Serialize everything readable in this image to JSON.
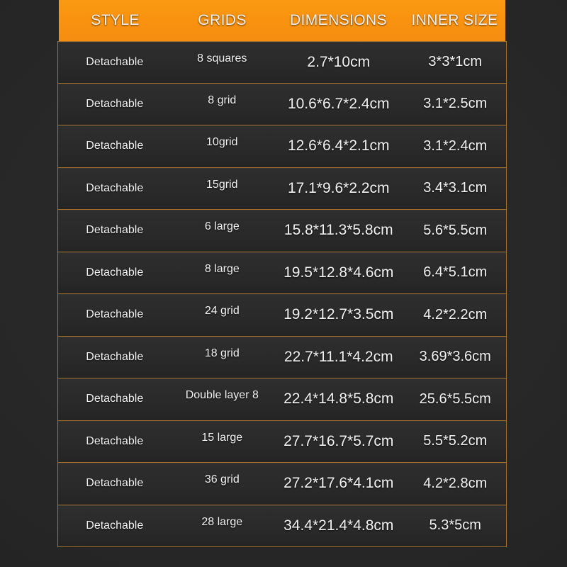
{
  "palette": {
    "background": "#262626",
    "header_orange": "#f9920f",
    "border_amber": "#a4702a",
    "cell_dark": "#2a2a2a",
    "text_white": "#f2f2f2",
    "header_text": "#fdf6e7"
  },
  "table": {
    "columns": [
      {
        "key": "style",
        "label": "STYLE"
      },
      {
        "key": "grids",
        "label": "GRIDS"
      },
      {
        "key": "dims",
        "label": "DIMENSIONS"
      },
      {
        "key": "inner",
        "label": "INNER SIZE"
      }
    ],
    "rows": [
      {
        "style": "Detachable",
        "grids": "8 squares",
        "dims": "2.7*10cm",
        "inner": "3*3*1cm"
      },
      {
        "style": "Detachable",
        "grids": "8 grid",
        "dims": "10.6*6.7*2.4cm",
        "inner": "3.1*2.5cm"
      },
      {
        "style": "Detachable",
        "grids": "10grid",
        "dims": "12.6*6.4*2.1cm",
        "inner": "3.1*2.4cm"
      },
      {
        "style": "Detachable",
        "grids": "15grid",
        "dims": "17.1*9.6*2.2cm",
        "inner": "3.4*3.1cm"
      },
      {
        "style": "Detachable",
        "grids": "6 large",
        "dims": "15.8*11.3*5.8cm",
        "inner": "5.6*5.5cm"
      },
      {
        "style": "Detachable",
        "grids": "8 large",
        "dims": "19.5*12.8*4.6cm",
        "inner": "6.4*5.1cm"
      },
      {
        "style": "Detachable",
        "grids": "24 grid",
        "dims": "19.2*12.7*3.5cm",
        "inner": "4.2*2.2cm"
      },
      {
        "style": "Detachable",
        "grids": "18 grid",
        "dims": "22.7*11.1*4.2cm",
        "inner": "3.69*3.6cm"
      },
      {
        "style": "Detachable",
        "grids": "Double layer 8",
        "dims": "22.4*14.8*5.8cm",
        "inner": "25.6*5.5cm"
      },
      {
        "style": "Detachable",
        "grids": "15 large",
        "dims": "27.7*16.7*5.7cm",
        "inner": "5.5*5.2cm"
      },
      {
        "style": "Detachable",
        "grids": "36 grid",
        "dims": "27.2*17.6*4.1cm",
        "inner": "4.2*2.8cm"
      },
      {
        "style": "Detachable",
        "grids": "28 large",
        "dims": "34.4*21.4*4.8cm",
        "inner": "5.3*5cm"
      }
    ]
  }
}
